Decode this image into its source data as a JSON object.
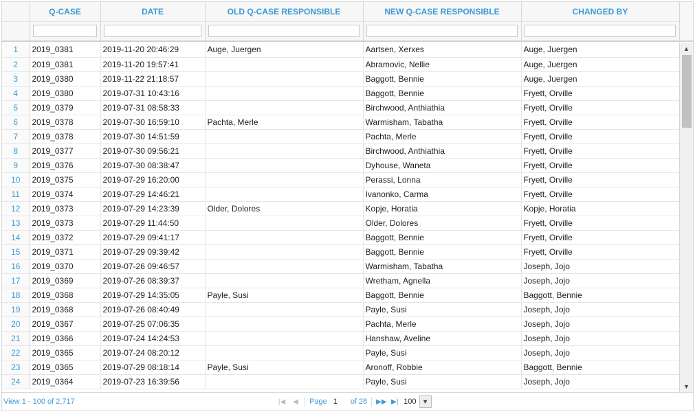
{
  "columns": {
    "case": "Q-CASE",
    "date": "DATE",
    "old": "OLD Q-CASE RESPONSIBLE",
    "new": "NEW Q-CASE RESPONSIBLE",
    "by": "CHANGED BY"
  },
  "filters": {
    "case": "",
    "date": "",
    "old": "",
    "new": "",
    "by": ""
  },
  "rows": [
    {
      "n": "1",
      "case": "2019_0381",
      "date": "2019-11-20 20:46:29",
      "old": "Auge, Juergen",
      "new": "Aartsen, Xerxes",
      "by": "Auge, Juergen"
    },
    {
      "n": "2",
      "case": "2019_0381",
      "date": "2019-11-20 19:57:41",
      "old": "",
      "new": "Abramovic, Nellie",
      "by": "Auge, Juergen"
    },
    {
      "n": "3",
      "case": "2019_0380",
      "date": "2019-11-22 21:18:57",
      "old": "",
      "new": "Baggott, Bennie",
      "by": "Auge, Juergen"
    },
    {
      "n": "4",
      "case": "2019_0380",
      "date": "2019-07-31 10:43:16",
      "old": "",
      "new": "Baggott, Bennie",
      "by": "Fryett, Orville"
    },
    {
      "n": "5",
      "case": "2019_0379",
      "date": "2019-07-31 08:58:33",
      "old": "",
      "new": "Birchwood, Anthiathia",
      "by": "Fryett, Orville"
    },
    {
      "n": "6",
      "case": "2019_0378",
      "date": "2019-07-30 16:59:10",
      "old": "Pachta, Merle",
      "new": "Warmisham, Tabatha",
      "by": "Fryett, Orville"
    },
    {
      "n": "7",
      "case": "2019_0378",
      "date": "2019-07-30 14:51:59",
      "old": "",
      "new": "Pachta, Merle",
      "by": "Fryett, Orville"
    },
    {
      "n": "8",
      "case": "2019_0377",
      "date": "2019-07-30 09:56:21",
      "old": "",
      "new": "Birchwood, Anthiathia",
      "by": "Fryett, Orville"
    },
    {
      "n": "9",
      "case": "2019_0376",
      "date": "2019-07-30 08:38:47",
      "old": "",
      "new": "Dyhouse, Waneta",
      "by": "Fryett, Orville"
    },
    {
      "n": "10",
      "case": "2019_0375",
      "date": "2019-07-29 16:20:00",
      "old": "",
      "new": "Perassi, Lonna",
      "by": "Fryett, Orville"
    },
    {
      "n": "11",
      "case": "2019_0374",
      "date": "2019-07-29 14:46:21",
      "old": "",
      "new": "Ivanonko, Carma",
      "by": "Fryett, Orville"
    },
    {
      "n": "12",
      "case": "2019_0373",
      "date": "2019-07-29 14:23:39",
      "old": "Older, Dolores",
      "new": "Kopje, Horatia",
      "by": "Kopje, Horatia"
    },
    {
      "n": "13",
      "case": "2019_0373",
      "date": "2019-07-29 11:44:50",
      "old": "",
      "new": "Older, Dolores",
      "by": "Fryett, Orville"
    },
    {
      "n": "14",
      "case": "2019_0372",
      "date": "2019-07-29 09:41:17",
      "old": "",
      "new": "Baggott, Bennie",
      "by": "Fryett, Orville"
    },
    {
      "n": "15",
      "case": "2019_0371",
      "date": "2019-07-29 09:39:42",
      "old": "",
      "new": "Baggott, Bennie",
      "by": "Fryett, Orville"
    },
    {
      "n": "16",
      "case": "2019_0370",
      "date": "2019-07-26 09:46:57",
      "old": "",
      "new": "Warmisham, Tabatha",
      "by": "Joseph, Jojo"
    },
    {
      "n": "17",
      "case": "2019_0369",
      "date": "2019-07-26 08:39:37",
      "old": "",
      "new": "Wretham, Agnella",
      "by": "Joseph, Jojo"
    },
    {
      "n": "18",
      "case": "2019_0368",
      "date": "2019-07-29 14:35:05",
      "old": "Payle, Susi",
      "new": "Baggott, Bennie",
      "by": "Baggott, Bennie"
    },
    {
      "n": "19",
      "case": "2019_0368",
      "date": "2019-07-26 08:40:49",
      "old": "",
      "new": "Payle, Susi",
      "by": "Joseph, Jojo"
    },
    {
      "n": "20",
      "case": "2019_0367",
      "date": "2019-07-25 07:06:35",
      "old": "",
      "new": "Pachta, Merle",
      "by": "Joseph, Jojo"
    },
    {
      "n": "21",
      "case": "2019_0366",
      "date": "2019-07-24 14:24:53",
      "old": "",
      "new": "Hanshaw, Aveline",
      "by": "Joseph, Jojo"
    },
    {
      "n": "22",
      "case": "2019_0365",
      "date": "2019-07-24 08:20:12",
      "old": "",
      "new": "Payle, Susi",
      "by": "Joseph, Jojo"
    },
    {
      "n": "23",
      "case": "2019_0365",
      "date": "2019-07-29 08:18:14",
      "old": "Payle, Susi",
      "new": "Aronoff, Robbie",
      "by": "Baggott, Bennie"
    },
    {
      "n": "24",
      "case": "2019_0364",
      "date": "2019-07-23 16:39:56",
      "old": "",
      "new": "Payle, Susi",
      "by": "Joseph, Jojo"
    }
  ],
  "footer": {
    "view_text": "View 1 - 100 of 2,717",
    "page_label": "Page",
    "page_value": "1",
    "of_pages": "of 28",
    "rows_per_page": "100",
    "first_icon": "first-page-icon",
    "prev_icon": "prev-page-icon",
    "next_icon": "next-page-icon",
    "last_icon": "last-page-icon"
  },
  "colors": {
    "accent": "#3a9bd4",
    "border": "#d6d6d6"
  }
}
